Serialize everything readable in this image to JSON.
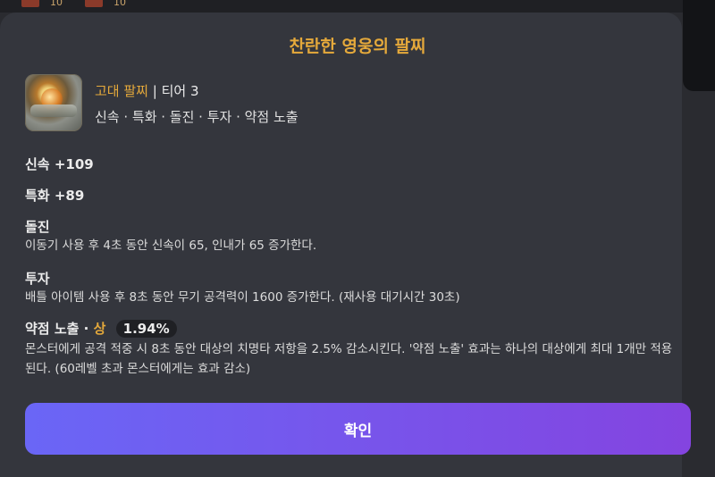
{
  "background": {
    "counts": [
      "10",
      "10"
    ]
  },
  "modal": {
    "title": "찬란한 영웅의 팔찌",
    "item": {
      "icon": "bracelet-icon",
      "grade": "고대 팔찌",
      "separator": "|",
      "tier": "티어 3",
      "tags": "신속 · 특화 · 돌진 · 투자 · 약점 노출"
    },
    "stats": [
      {
        "label": "신속 +109"
      },
      {
        "label": "특화 +89"
      }
    ],
    "effects": [
      {
        "title": "돌진",
        "description": "이동기 사용 후 4초 동안 신속이 65, 인내가 65 증가한다."
      },
      {
        "title": "투자",
        "description": "배틀 아이템 사용 후 8초 동안 무기 공격력이 1600 증가한다. (재사용 대기시간 30초)"
      },
      {
        "title": "약점 노출",
        "dot": "·",
        "grade": "상",
        "percent": "1.94%",
        "description_line1": "몬스터에게 공격 적중 시 8초 동안 대상의 치명타 저항을 2.5% 감소시킨다. '약점 노출' 효과는 하나의 대상에게 최대 1개만 적용",
        "description_line2": "된다. (60레벨 초과 몬스터에게는 효과 감소)"
      }
    ],
    "confirm_label": "확인"
  },
  "colors": {
    "accent": "#e5a93b",
    "button_start": "#6a66f6",
    "button_end": "#8444e0",
    "panel": "#34363d"
  }
}
